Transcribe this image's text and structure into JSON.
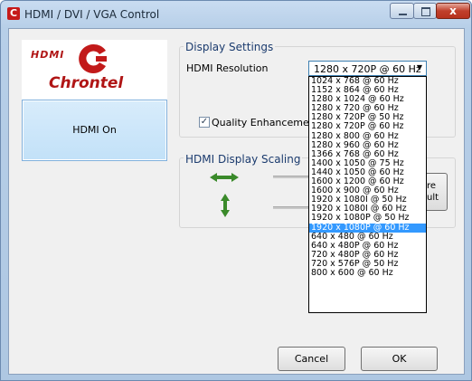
{
  "window": {
    "title": "HDMI / DVI / VGA Control",
    "close_glyph": "x",
    "app_icon_letter": "C"
  },
  "logo": {
    "hdmi_text": "HDMI",
    "brand_text": "Chrontel"
  },
  "left_panel": {
    "hdmi_on_label": "HDMI On"
  },
  "display_settings": {
    "group_title": "Display Settings",
    "resolution_label": "HDMI Resolution",
    "resolution_value": "1280 x 720P @ 60 Hz",
    "quality_label": "Quality Enhancement",
    "quality_checked_glyph": "✓",
    "options": [
      "1024 x 768 @ 60 Hz",
      "1152 x 864 @ 60 Hz",
      "1280 x 1024 @ 60 Hz",
      "1280 x 720 @ 60 Hz",
      "1280 x 720P @ 50 Hz",
      "1280 x 720P @ 60 Hz",
      "1280 x 800 @ 60 Hz",
      "1280 x 960 @ 60 Hz",
      "1366 x 768 @ 60 Hz",
      "1400 x 1050 @ 75 Hz",
      "1440 x 1050 @ 60 Hz",
      "1600 x 1200 @ 60 Hz",
      "1600 x 900 @ 60 Hz",
      "1920 x 1080I @ 50 Hz",
      "1920 x 1080I @ 60 Hz",
      "1920 x 1080P @ 50 Hz",
      "1920 x 1080P @ 60 Hz",
      "640 x 480 @ 60 Hz",
      "640 x 480P @ 60 Hz",
      "720 x 480P @ 60 Hz",
      "720 x 576P @ 50 Hz",
      "800 x 600 @ 60 Hz"
    ],
    "highlighted_option": "1920 x 1080P @ 60 Hz"
  },
  "scaling": {
    "group_title": "HDMI Display Scaling",
    "restore_label_line1": "re",
    "restore_label_line2": "ult",
    "arrow_color": "#3a8a2a"
  },
  "footer": {
    "cancel_label": "Cancel",
    "ok_label": "OK"
  }
}
